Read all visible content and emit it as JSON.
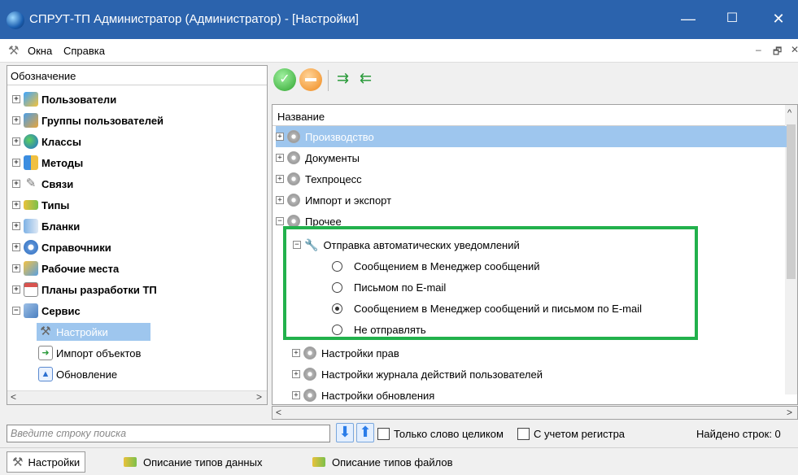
{
  "window": {
    "title": "СПРУТ-ТП Администратор (Администратор) - [Настройки]",
    "minimize": "—",
    "maximize": "☐",
    "close": "✕"
  },
  "menu": {
    "items": [
      "Окна",
      "Справка"
    ],
    "mdi_min": "–",
    "mdi_restore": "🗗",
    "mdi_close": "✕"
  },
  "left_tree": {
    "header": "Обозначение",
    "items": [
      {
        "label": "Пользователи"
      },
      {
        "label": "Группы пользователей"
      },
      {
        "label": "Классы"
      },
      {
        "label": "Методы"
      },
      {
        "label": "Связи"
      },
      {
        "label": "Типы"
      },
      {
        "label": "Бланки"
      },
      {
        "label": "Справочники"
      },
      {
        "label": "Рабочие места"
      },
      {
        "label": "Планы разработки ТП"
      },
      {
        "label": "Сервис"
      }
    ],
    "children": [
      {
        "label": "Настройки"
      },
      {
        "label": "Импорт объектов"
      },
      {
        "label": "Обновление"
      }
    ]
  },
  "grid": {
    "header": "Название",
    "rows": [
      {
        "label": "Производство"
      },
      {
        "label": "Документы"
      },
      {
        "label": "Техпроцесс"
      },
      {
        "label": "Импорт и экспорт"
      },
      {
        "label": "Прочее"
      }
    ],
    "group": {
      "label": "Отправка автоматических уведомлений",
      "options": [
        {
          "label": "Сообщением в Менеджер сообщений",
          "selected": false
        },
        {
          "label": "Письмом по E-mail",
          "selected": false
        },
        {
          "label": "Сообщением в Менеджер сообщений и письмом по E-mail",
          "selected": true
        },
        {
          "label": "Не отправлять",
          "selected": false
        }
      ]
    },
    "after": [
      {
        "label": "Настройки прав"
      },
      {
        "label": "Настройки журнала действий пользователей"
      },
      {
        "label": "Настройки обновления"
      }
    ],
    "highlight_color": "#22b14c"
  },
  "search": {
    "placeholder": "Введите строку поиска",
    "whole_word": "Только слово целиком",
    "match_case": "С учетом регистра",
    "found": "Найдено строк: 0"
  },
  "status_tabs": [
    "Настройки",
    "Описание типов данных",
    "Описание типов файлов"
  ]
}
